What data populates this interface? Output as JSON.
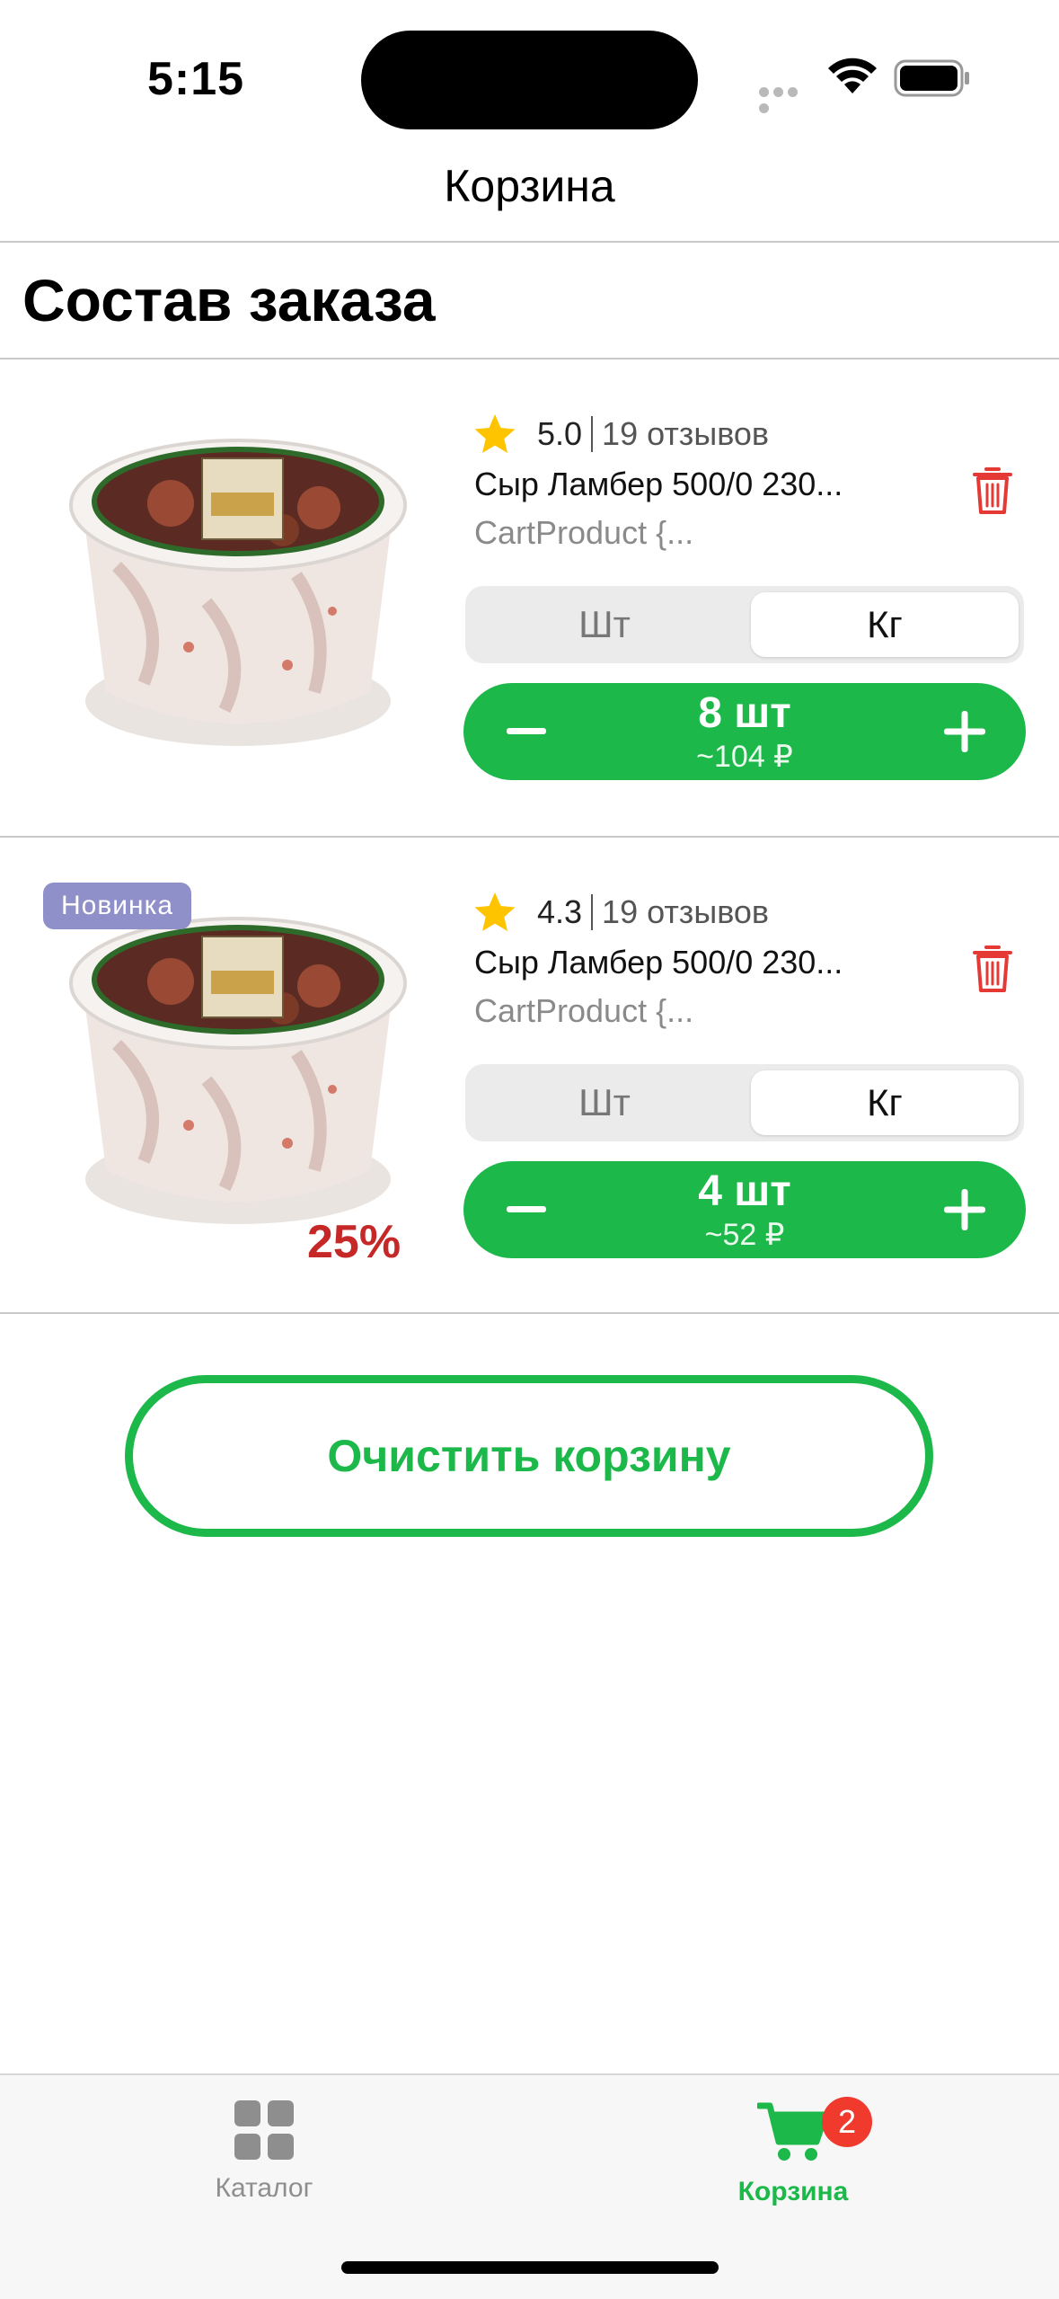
{
  "status_bar": {
    "time": "5:15"
  },
  "header": {
    "title": "Корзина"
  },
  "section": {
    "title": "Состав заказа"
  },
  "items": [
    {
      "rating": "5.0",
      "reviews": "19 отзывов",
      "name": "Сыр Ламбер 500/0 230...",
      "subtitle": "CartProduct {...",
      "unit_options": [
        "Шт",
        "Кг"
      ],
      "selected_unit": "Кг",
      "quantity": "8 шт",
      "price": "~104 ₽",
      "badge": "",
      "discount": ""
    },
    {
      "rating": "4.3",
      "reviews": "19 отзывов",
      "name": "Сыр Ламбер 500/0 230...",
      "subtitle": "CartProduct {...",
      "unit_options": [
        "Шт",
        "Кг"
      ],
      "selected_unit": "Кг",
      "quantity": "4 шт",
      "price": "~52 ₽",
      "badge": "Новинка",
      "discount": "25%"
    }
  ],
  "actions": {
    "clear_cart": "Очистить корзину"
  },
  "tab_bar": {
    "catalog": {
      "label": "Каталог",
      "icon": "grid-icon"
    },
    "cart": {
      "label": "Корзина",
      "icon": "cart-icon",
      "badge": "2"
    }
  },
  "colors": {
    "accent": "#1cb84a",
    "badge_new": "#8f8fc9",
    "discount": "#c62828",
    "delete": "#e53935",
    "star": "#ffc400"
  }
}
